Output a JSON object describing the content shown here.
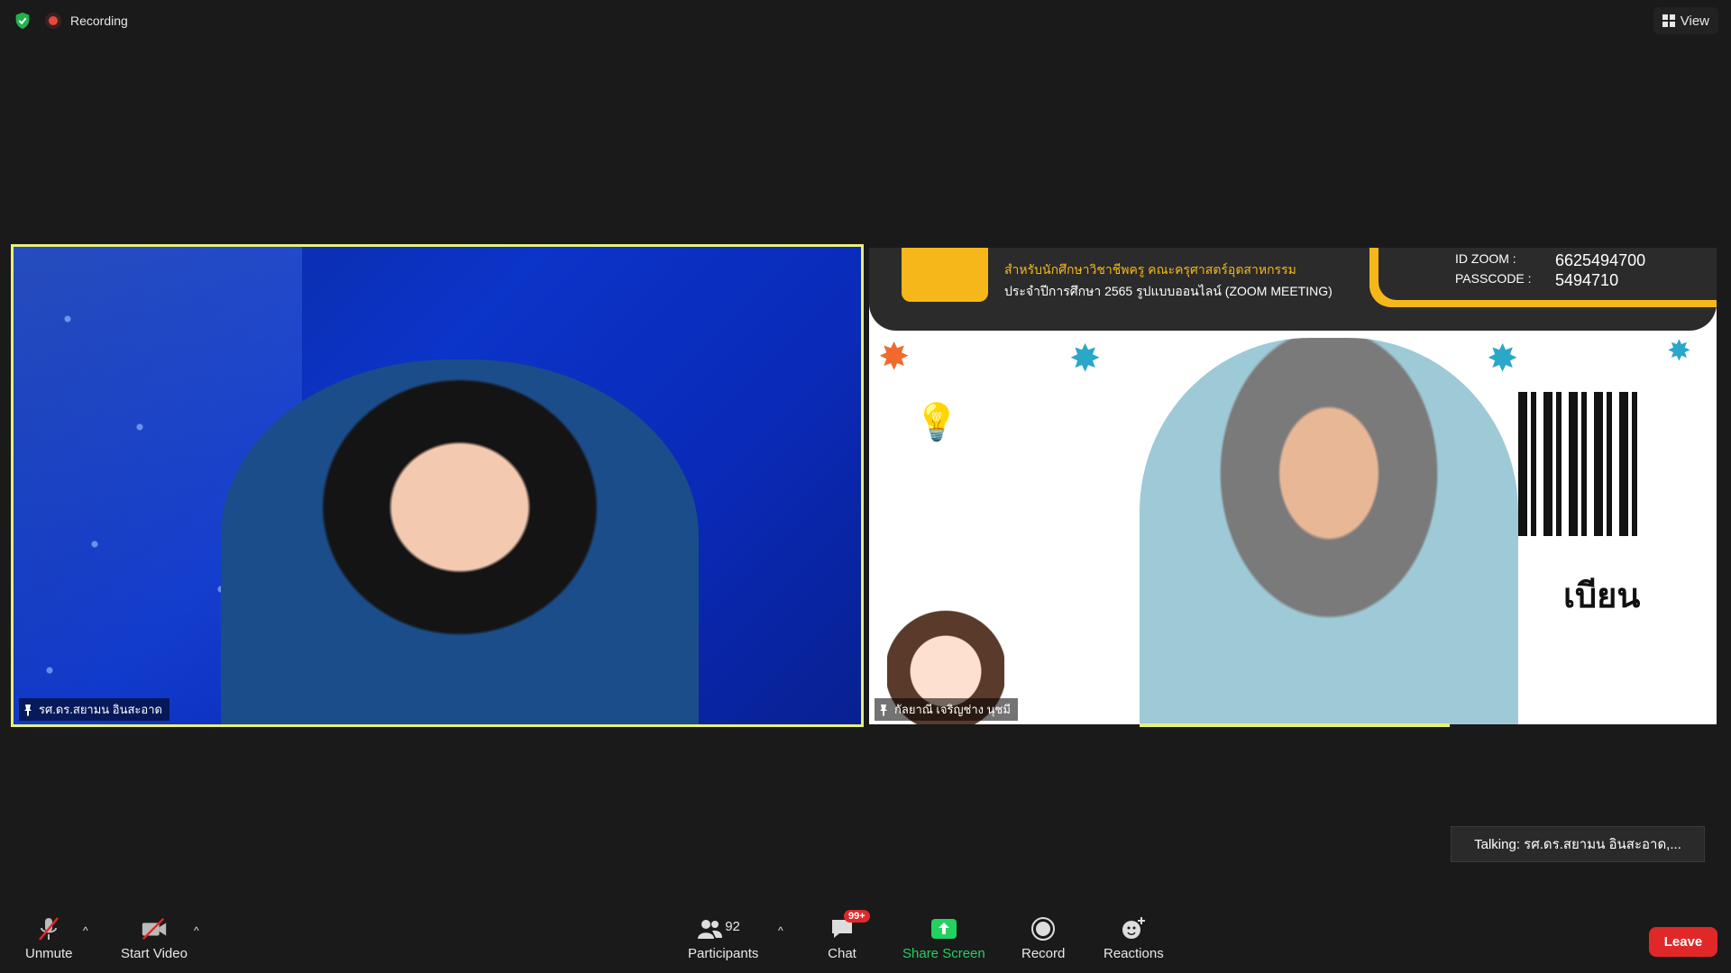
{
  "status": {
    "recording_label": "Recording"
  },
  "view_button": {
    "label": "View"
  },
  "tiles": [
    {
      "name_label": "รศ.ดร.สยามน อินสะอาด",
      "active_speaker": true
    },
    {
      "name_label": "กัลยาณี เจริญช่าง นุชมี",
      "banner_line1": "สำหรับนักศึกษาวิชาชีพครู คณะครุศาสตร์อุตสาหกรรม",
      "banner_line2": "ประจำปีการศึกษา 2565 รูปแบบออนไลน์ (ZOOM MEETING)",
      "zoom_id_key": "ID ZOOM :",
      "zoom_id_value": "6625494700",
      "passcode_key": "PASSCODE :",
      "passcode_value": "5494710",
      "qr_caption": "เบียน"
    }
  ],
  "talking_toast": "Talking: รศ.ดร.สยามน อินสะอาด,...",
  "toolbar": {
    "unmute": "Unmute",
    "start_video": "Start Video",
    "participants": "Participants",
    "participants_count": "92",
    "chat": "Chat",
    "chat_badge": "99+",
    "share_screen": "Share Screen",
    "record": "Record",
    "reactions": "Reactions",
    "leave": "Leave"
  },
  "colors": {
    "background": "#1a1a1a",
    "active_speaker_border": "#e7f07a",
    "share_green": "#23d160",
    "leave_red": "#e02828",
    "banner_yellow": "#f6b71a"
  }
}
